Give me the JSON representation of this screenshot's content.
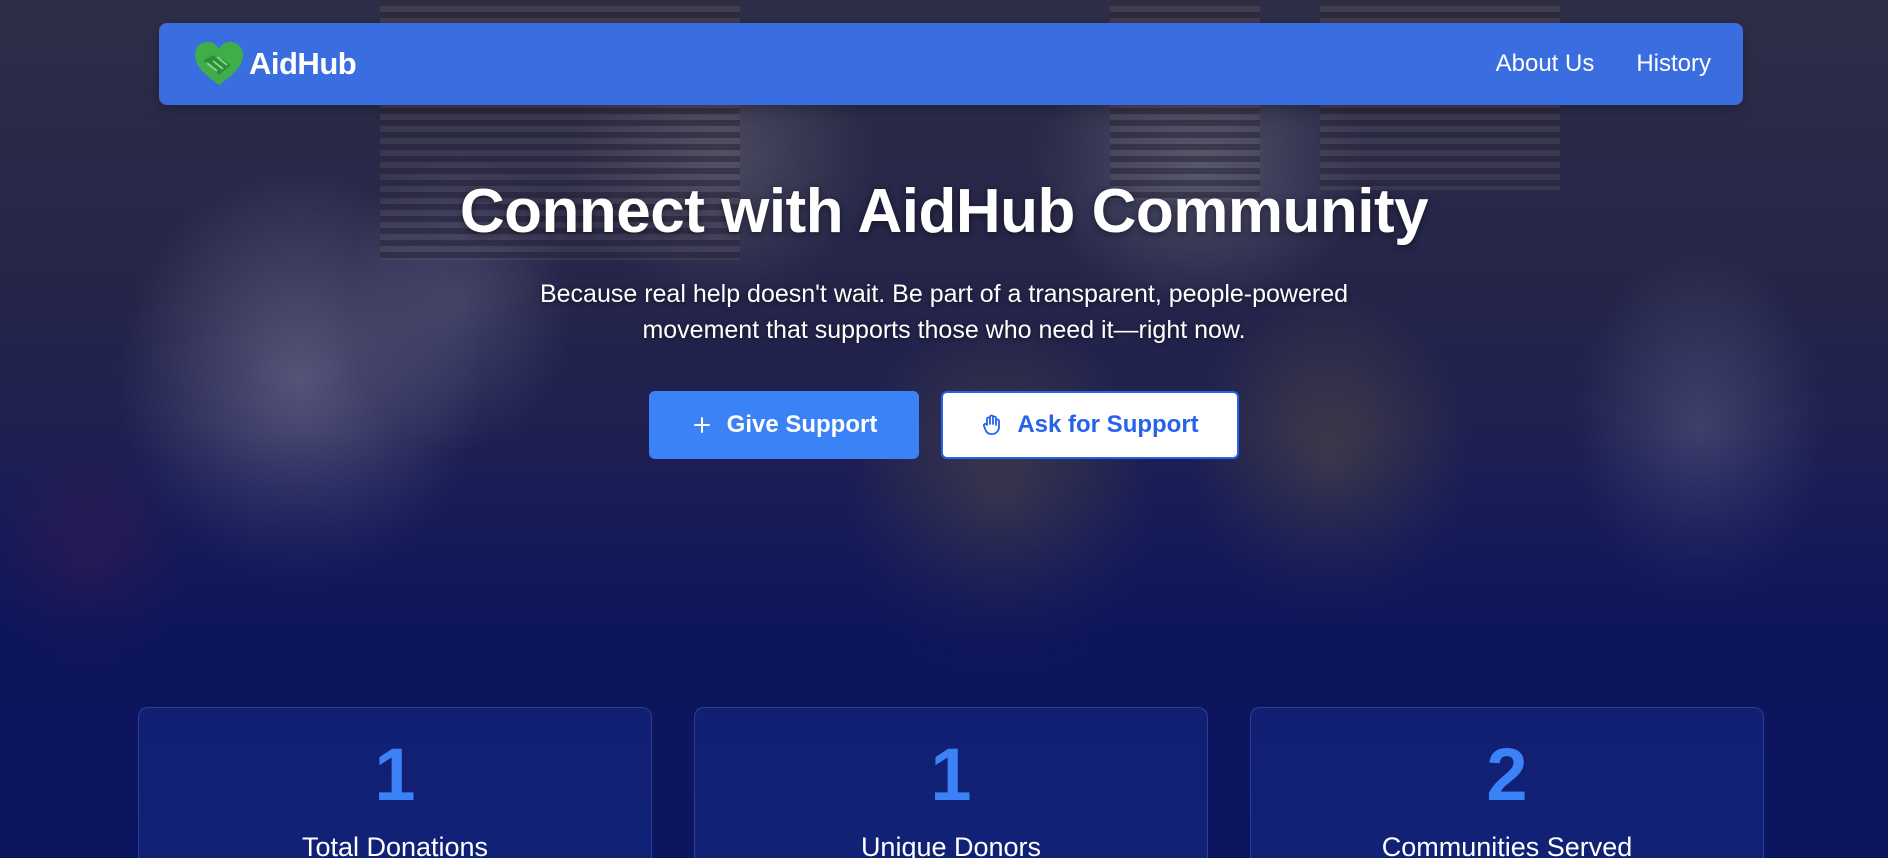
{
  "brand": {
    "name": "AidHub",
    "logo_icon": "heart-handshake-icon",
    "logo_color": "#3fae49"
  },
  "nav": {
    "links": [
      {
        "label": "About Us"
      },
      {
        "label": "History"
      }
    ]
  },
  "hero": {
    "title": "Connect with AidHub Community",
    "subtitle": "Because real help doesn't wait. Be part of a transparent, people-powered movement that supports those who need it—right now."
  },
  "cta": {
    "give": {
      "label": "Give Support",
      "icon": "plus-icon"
    },
    "ask": {
      "label": "Ask for Support",
      "icon": "hand-icon"
    }
  },
  "stats": [
    {
      "value": "1",
      "label": "Total Donations"
    },
    {
      "value": "1",
      "label": "Unique Donors"
    },
    {
      "value": "2",
      "label": "Communities Served"
    }
  ],
  "colors": {
    "navbar": "#3a6ee0",
    "primary": "#3b82f6",
    "accent_text": "#2563eb",
    "background": "#0c1450"
  }
}
